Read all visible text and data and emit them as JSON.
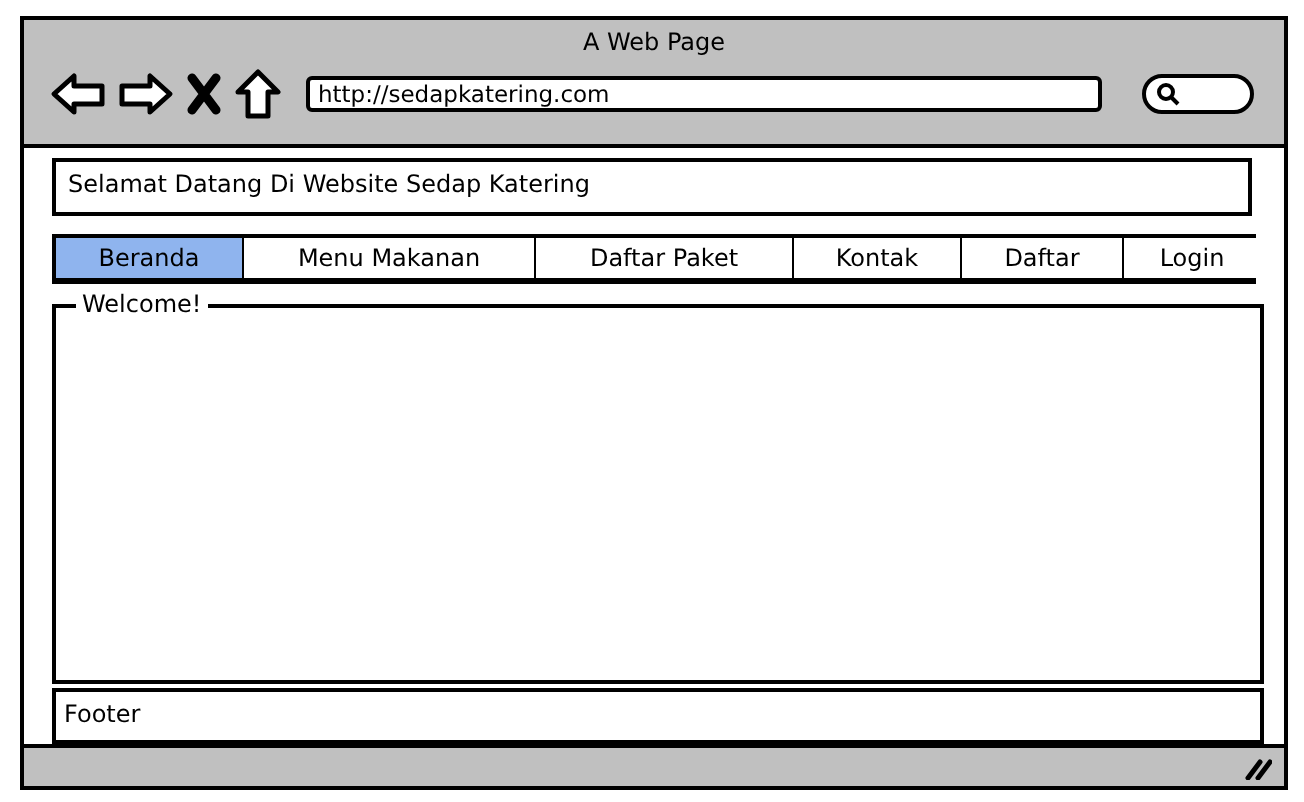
{
  "window": {
    "title": "A Web Page"
  },
  "address_bar": {
    "value": "http://sedapkatering.com"
  },
  "header": {
    "text": "Selamat Datang Di Website Sedap Katering"
  },
  "tabs": [
    {
      "label": "Beranda",
      "selected": true
    },
    {
      "label": "Menu Makanan",
      "selected": false
    },
    {
      "label": "Daftar Paket",
      "selected": false
    },
    {
      "label": "Kontak",
      "selected": false
    },
    {
      "label": "Daftar",
      "selected": false
    },
    {
      "label": "Login",
      "selected": false
    }
  ],
  "content": {
    "legend": "Welcome!"
  },
  "footer": {
    "text": "Footer"
  }
}
